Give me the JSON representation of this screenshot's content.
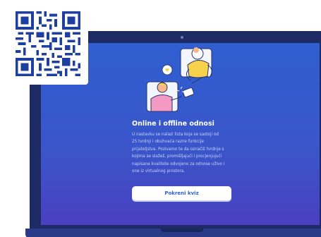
{
  "quiz": {
    "title": "Online i offline odnosi",
    "description_lines": [
      "U nastavku se nalazi lista koja se sastoji od",
      "25 tvrdnji i obuhvaća razne funkcije",
      "prijateljstva. Pozivamo te da označiš tvrdnje s",
      "kojima se slažeš, promišljajući i procjenjujući",
      "napisane kvalitete odvojeno za odnose uživo i",
      "one iz virtualnog prostora."
    ],
    "start_button_label": "Pokreni kviz"
  },
  "colors": {
    "screen_top": "#2f5fd0",
    "screen_bottom": "#4a3fc0",
    "laptop_frame": "#1d2a63",
    "button_bg": "#ffffff",
    "button_text": "#2f5fd0"
  },
  "icons": {
    "qr": "qr-code-icon",
    "illustration": "friends-illustration"
  }
}
